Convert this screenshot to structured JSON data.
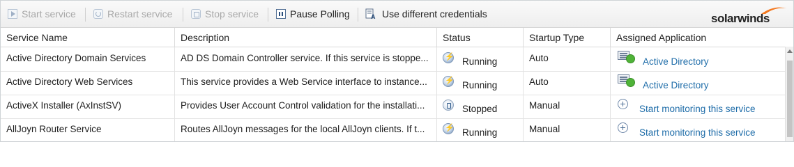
{
  "toolbar": {
    "start_label": "Start service",
    "restart_label": "Restart service",
    "stop_label": "Stop service",
    "pause_label": "Pause Polling",
    "credentials_label": "Use different credentials",
    "logo": "solarwinds"
  },
  "table": {
    "columns": [
      "Service Name",
      "Description",
      "Status",
      "Startup Type",
      "Assigned Application"
    ],
    "rows": [
      {
        "name": "Active Directory Domain Services",
        "description": "AD DS Domain Controller service. If this service is stoppe...",
        "status": "Running",
        "startup": "Auto",
        "app": "Active Directory",
        "app_kind": "assigned"
      },
      {
        "name": "Active Directory Web Services",
        "description": "This service provides a Web Service interface to instance...",
        "status": "Running",
        "startup": "Auto",
        "app": "Active Directory",
        "app_kind": "assigned"
      },
      {
        "name": "ActiveX Installer (AxInstSV)",
        "description": "Provides User Account Control validation for the installati...",
        "status": "Stopped",
        "startup": "Manual",
        "app": "Start monitoring this service",
        "app_kind": "monitor"
      },
      {
        "name": "AllJoyn Router Service",
        "description": "Routes AllJoyn messages for the local AllJoyn clients. If t...",
        "status": "Running",
        "startup": "Manual",
        "app": "Start monitoring this service",
        "app_kind": "monitor"
      }
    ]
  },
  "colors": {
    "link": "#1f6da9",
    "running_icon": "#2b5d99",
    "app_ok": "#4fb338"
  }
}
